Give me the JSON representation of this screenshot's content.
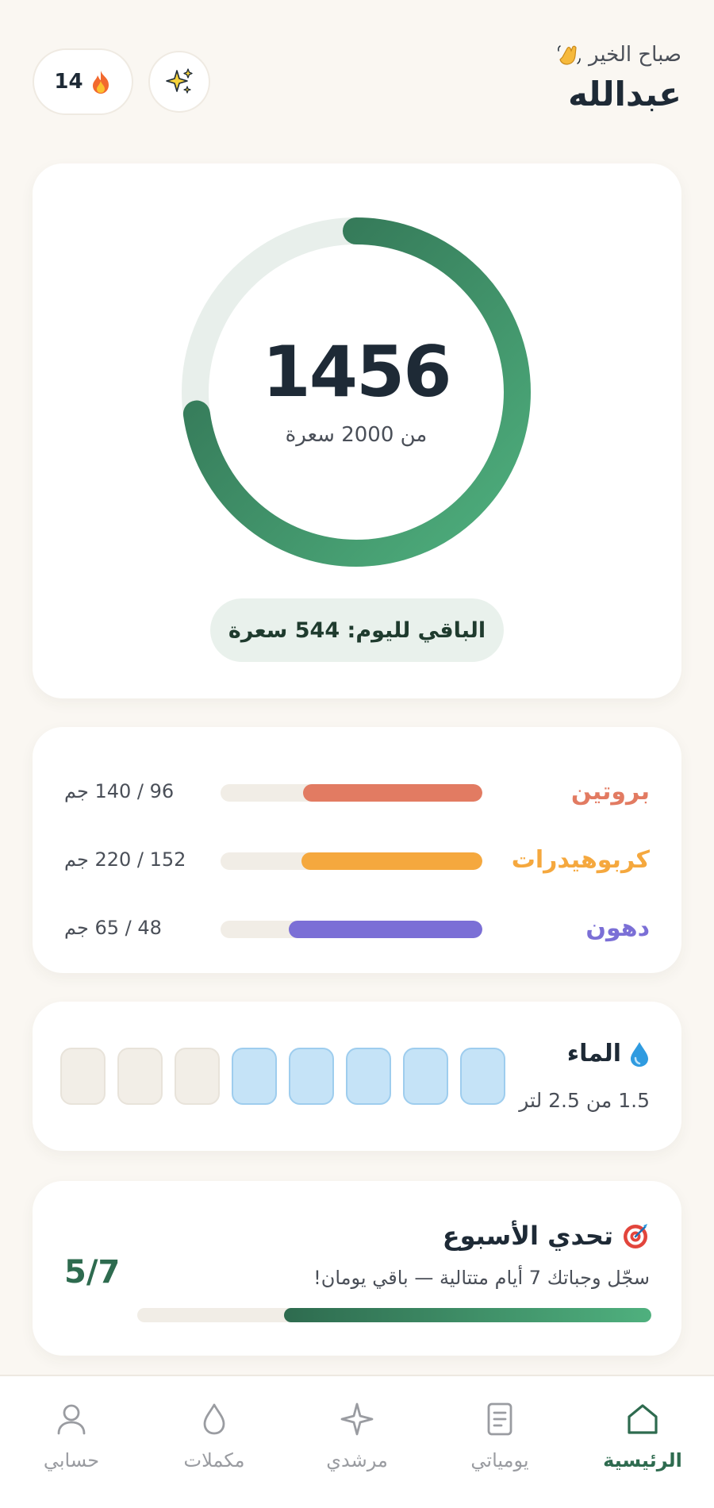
{
  "header": {
    "greeting": "صباح الخير",
    "greeting_icon": "waving-hand-icon",
    "username": "عبدالله",
    "streak_count": "14",
    "streak_icon": "fire-icon",
    "sparkle_icon": "sparkles-icon"
  },
  "calories": {
    "consumed": "1456",
    "goal_text": "من 2000 سعرة",
    "progress_fraction": 0.728,
    "remaining_text": "الباقي لليوم: 544 سعرة",
    "colors": {
      "track": "#E8EFEB",
      "start": "#4FB07E",
      "end": "#2E6B4F"
    }
  },
  "macros": [
    {
      "name": "بروتين",
      "value_text": "96 / 140 جم",
      "fraction": 0.686,
      "color": "#E27B62"
    },
    {
      "name": "كربوهيدرات",
      "value_text": "152 / 220 جم",
      "fraction": 0.691,
      "color": "#F5A83E"
    },
    {
      "name": "دهون",
      "value_text": "48 / 65 جم",
      "fraction": 0.738,
      "color": "#7B6FD6"
    }
  ],
  "water": {
    "title": "الماء",
    "icon": "water-drop-icon",
    "subtitle": "1.5 من 2.5 لتر",
    "cups_total": 8,
    "cups_filled": 5
  },
  "challenge": {
    "title": "تحدي الأسبوع",
    "icon": "target-icon",
    "description": "سجّل وجباتك 7 أيام متتالية — باقي يومان!",
    "count": "5/7",
    "fraction": 0.714
  },
  "nav": {
    "items": [
      {
        "label": "الرئيسية",
        "icon": "home-icon",
        "active": true
      },
      {
        "label": "يومياتي",
        "icon": "journal-icon",
        "active": false
      },
      {
        "label": "مرشدي",
        "icon": "sparkle-icon",
        "active": false
      },
      {
        "label": "مكملات",
        "icon": "drop-icon",
        "active": false
      },
      {
        "label": "حسابي",
        "icon": "profile-icon",
        "active": false
      }
    ]
  }
}
